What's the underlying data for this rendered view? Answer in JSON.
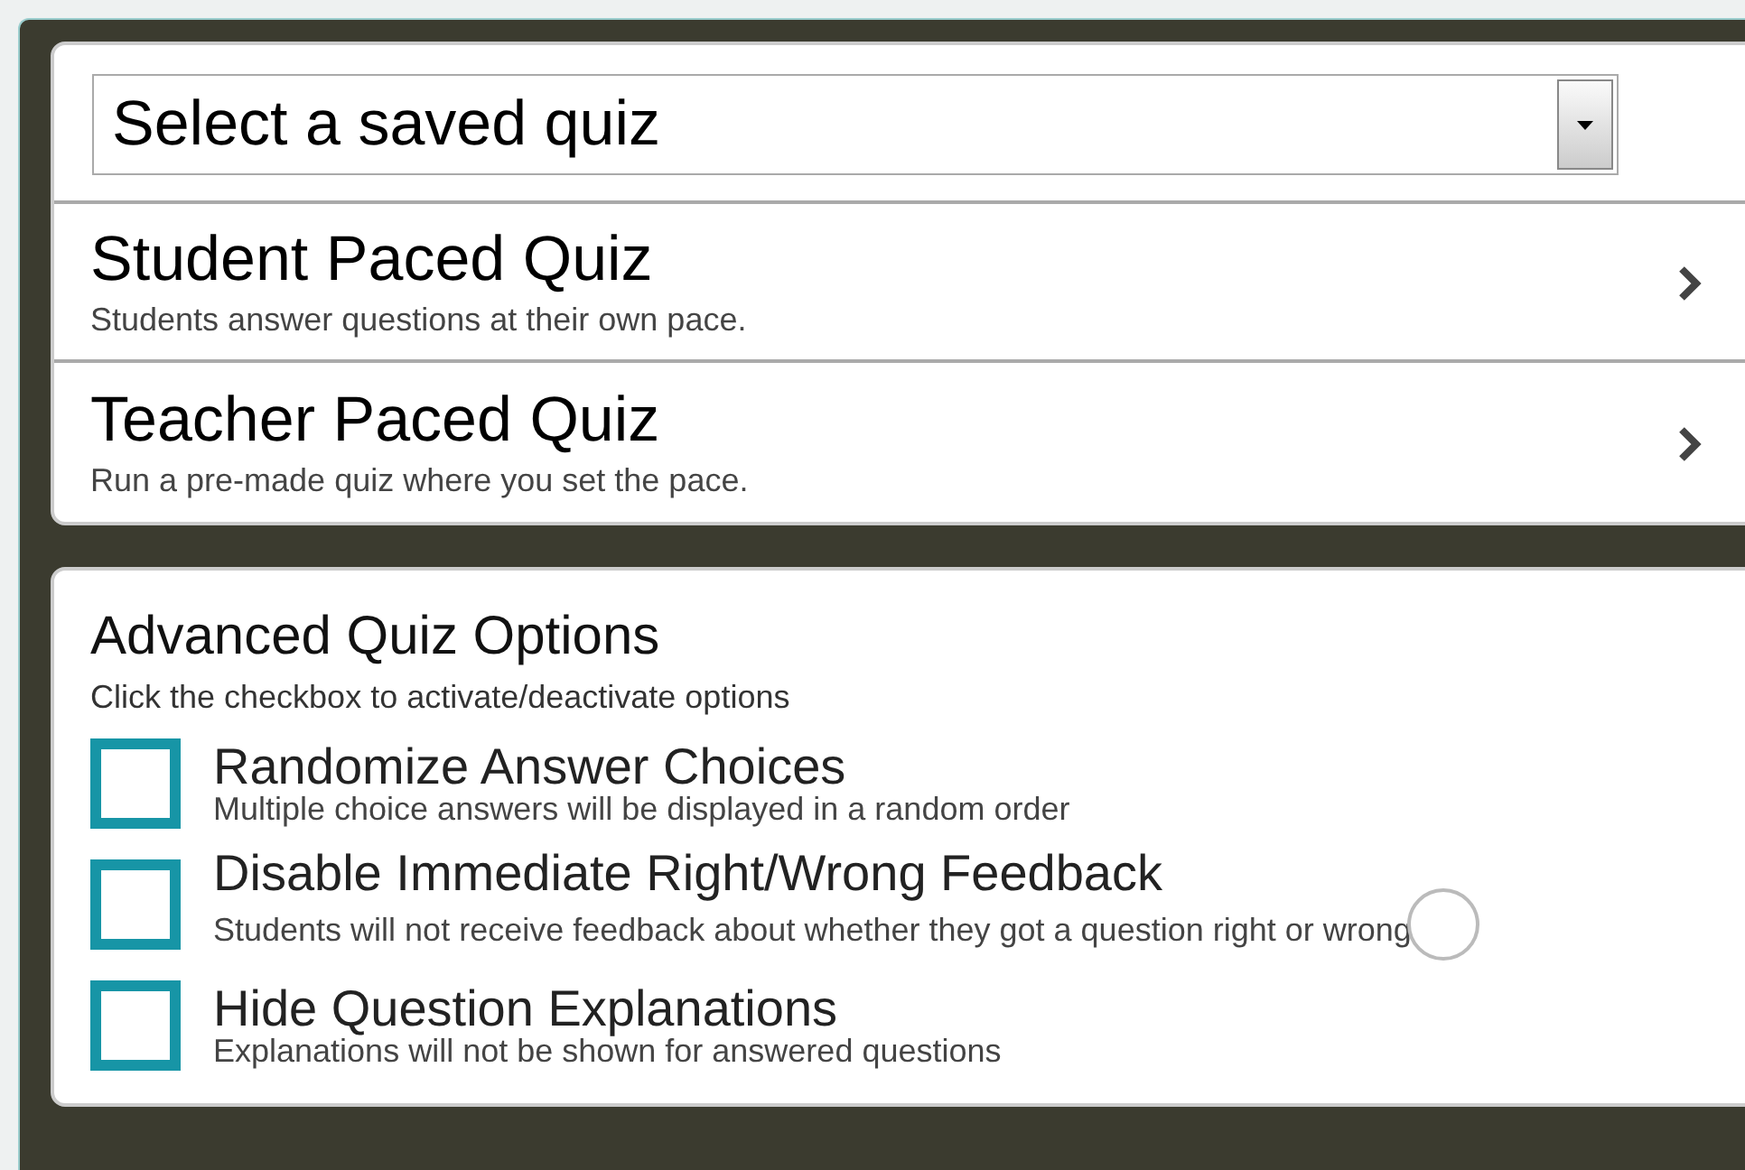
{
  "quiz_select": {
    "placeholder": "Select a saved quiz"
  },
  "quiz_types": [
    {
      "title": "Student Paced Quiz",
      "description": "Students answer questions at their own pace."
    },
    {
      "title": "Teacher Paced Quiz",
      "description": "Run a pre-made quiz where you set the pace."
    }
  ],
  "advanced_options": {
    "title": "Advanced Quiz Options",
    "subtitle": "Click the checkbox to activate/deactivate options",
    "options": [
      {
        "label": "Randomize Answer Choices",
        "description": "Multiple choice answers will be displayed in a random order",
        "checked": false
      },
      {
        "label": "Disable Immediate Right/Wrong Feedback",
        "description": "Students will not receive feedback about whether they got a question right or wrong",
        "checked": false
      },
      {
        "label": "Hide Question Explanations",
        "description": "Explanations will not be shown for answered questions",
        "checked": false
      }
    ]
  }
}
